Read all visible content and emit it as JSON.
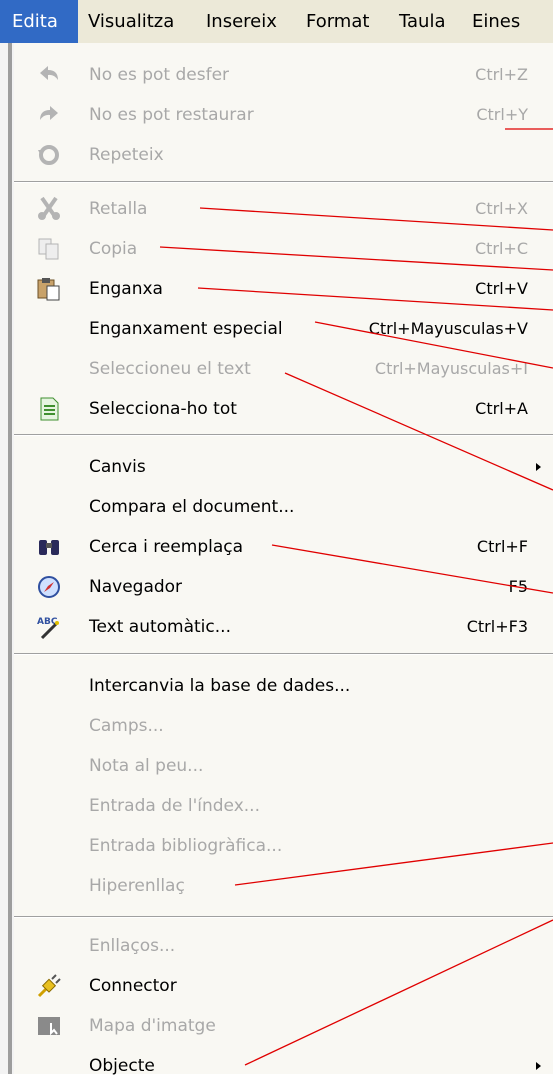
{
  "menubar": {
    "items": [
      "Edita",
      "Visualitza",
      "Insereix",
      "Format",
      "Taula",
      "Eines"
    ]
  },
  "menu": {
    "undo": {
      "label": "No es pot desfer",
      "shortcut": "Ctrl+Z"
    },
    "redo": {
      "label": "No es pot restaurar",
      "shortcut": "Ctrl+Y"
    },
    "repeat": {
      "label": "Repeteix"
    },
    "cut": {
      "label": "Retalla",
      "shortcut": "Ctrl+X"
    },
    "copy": {
      "label": "Copia",
      "shortcut": "Ctrl+C"
    },
    "paste": {
      "label": "Enganxa",
      "shortcut": "Ctrl+V"
    },
    "paste_special": {
      "label": "Enganxament especial",
      "shortcut": "Ctrl+Mayusculas+V"
    },
    "select_text": {
      "label": "Seleccioneu el text",
      "shortcut": "Ctrl+Mayusculas+I"
    },
    "select_all": {
      "label": "Selecciona-ho tot",
      "shortcut": "Ctrl+A"
    },
    "changes": {
      "label": "Canvis"
    },
    "compare": {
      "label": "Compara el document..."
    },
    "find_replace": {
      "label": "Cerca i reemplaça",
      "shortcut": "Ctrl+F"
    },
    "navigator": {
      "label": "Navegador",
      "shortcut": "F5"
    },
    "autotext": {
      "label": "Text automàtic...",
      "shortcut": "Ctrl+F3"
    },
    "exchange_db": {
      "label": "Intercanvia la base de dades..."
    },
    "fields": {
      "label": "Camps..."
    },
    "footnote": {
      "label": "Nota al peu..."
    },
    "index_entry": {
      "label": "Entrada de l'índex..."
    },
    "biblio_entry": {
      "label": "Entrada bibliogràfica..."
    },
    "hyperlink": {
      "label": "Hiperenllaç"
    },
    "links": {
      "label": "Enllaços..."
    },
    "connector": {
      "label": "Connector"
    },
    "image_map": {
      "label": "Mapa d'imatge"
    },
    "object": {
      "label": "Objecte"
    }
  },
  "colors": {
    "menubar_bg": "#ece9d8",
    "menu_bg": "#f9f8f3",
    "active_bg": "#316ac5",
    "disabled_text": "#a8a8a8",
    "annotation_line": "#e00000"
  }
}
